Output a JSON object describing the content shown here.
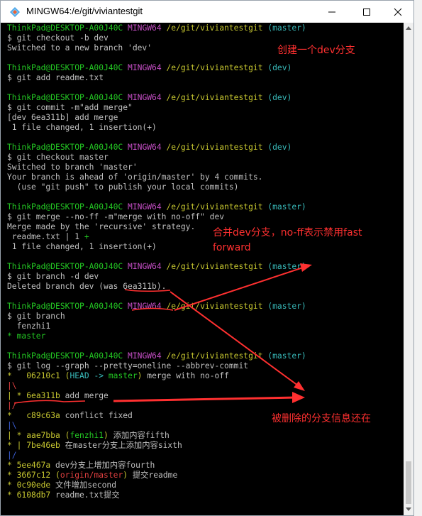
{
  "window": {
    "title": "MINGW64:/e/git/viviantestgit"
  },
  "prompts": [
    {
      "user": "ThinkPad@DESKTOP-A00J40C",
      "env": "MINGW64",
      "path": "/e/git/viviantestgit",
      "branch": "(master)"
    },
    {
      "user": "ThinkPad@DESKTOP-A00J40C",
      "env": "MINGW64",
      "path": "/e/git/viviantestgit",
      "branch": "(dev)"
    },
    {
      "user": "ThinkPad@DESKTOP-A00J40C",
      "env": "MINGW64",
      "path": "/e/git/viviantestgit",
      "branch": "(dev)"
    },
    {
      "user": "ThinkPad@DESKTOP-A00J40C",
      "env": "MINGW64",
      "path": "/e/git/viviantestgit",
      "branch": "(dev)"
    },
    {
      "user": "ThinkPad@DESKTOP-A00J40C",
      "env": "MINGW64",
      "path": "/e/git/viviantestgit",
      "branch": "(master)"
    },
    {
      "user": "ThinkPad@DESKTOP-A00J40C",
      "env": "MINGW64",
      "path": "/e/git/viviantestgit",
      "branch": "(master)"
    },
    {
      "user": "ThinkPad@DESKTOP-A00J40C",
      "env": "MINGW64",
      "path": "/e/git/viviantestgit",
      "branch": "(master)"
    },
    {
      "user": "ThinkPad@DESKTOP-A00J40C",
      "env": "MINGW64",
      "path": "/e/git/viviantestgit",
      "branch": "(master)"
    }
  ],
  "commands": [
    "$ git checkout -b dev",
    "$ git add readme.txt",
    "$ git commit -m\"add merge\"",
    "$ git checkout master",
    "$ git merge --no-ff -m\"merge with no-off\" dev",
    "$ git branch -d dev",
    "$ git branch",
    "$ git log --graph --pretty=oneline --abbrev-commit"
  ],
  "outputs": {
    "checkout_dev": "Switched to a new branch 'dev'",
    "commit": [
      "[dev 6ea311b] add merge",
      " 1 file changed, 1 insertion(+)"
    ],
    "checkout_master": [
      "Switched to branch 'master'",
      "Your branch is ahead of 'origin/master' by 4 commits.",
      "  (use \"git push\" to publish your local commits)"
    ],
    "merge": [
      "Merge made by the 'recursive' strategy.",
      " readme.txt | 1 ",
      "+",
      " 1 file changed, 1 insertion(+)"
    ],
    "branch_delete": "Deleted branch dev (was 6ea311b).",
    "branch_list": [
      "  fenzhi1",
      "* master"
    ]
  },
  "log": [
    {
      "graph": "*   ",
      "hash": "06210c1",
      "ref_open": " (",
      "head": "HEAD -> ",
      "ref": "master",
      "ref_close": ")",
      "msg": " merge with no-off"
    },
    {
      "graph": "|\\",
      "hash": "",
      "msg": ""
    },
    {
      "graph": "| * ",
      "hash": "6ea311b",
      "msg": " add merge"
    },
    {
      "graph": "|/",
      "hash": "",
      "msg": ""
    },
    {
      "graph": "*   ",
      "hash": "c89c63a",
      "msg": " conflict fixed"
    },
    {
      "graph": "|\\",
      "hash": "",
      "msg": ""
    },
    {
      "graph": "| * ",
      "hash": "aae7bba",
      "ref_open": " (",
      "ref": "fenzhi1",
      "ref_close": ")",
      "msg": " 添加内容fifth"
    },
    {
      "graph": "* | ",
      "hash": "7be46eb",
      "msg": " 在master分支上添加内容sixth"
    },
    {
      "graph": "|/",
      "hash": "",
      "msg": ""
    },
    {
      "graph": "* ",
      "hash": "5ee467a",
      "msg": " dev分支上增加内容fourth"
    },
    {
      "graph": "* ",
      "hash": "3667c12",
      "ref_open": " (",
      "ref": "origin/master",
      "ref_close": ")",
      "msg": " 提交readme"
    },
    {
      "graph": "* ",
      "hash": "0c90ede",
      "msg": " 文件增加second"
    },
    {
      "graph": "* ",
      "hash": "6108db7",
      "msg": " readme.txt提交"
    }
  ],
  "annotations": {
    "create_branch": "创建一个dev分支",
    "merge_note_1": "合并dev分支，no-ff表示禁用fast",
    "merge_note_2": "forward",
    "deleted_info": "被删除的分支信息还在"
  },
  "colors": {
    "prompt_user": "#23c823",
    "env": "#c84fc8",
    "path": "#c8c830",
    "branch": "#39bcbc",
    "annotation": "#ff3030"
  }
}
